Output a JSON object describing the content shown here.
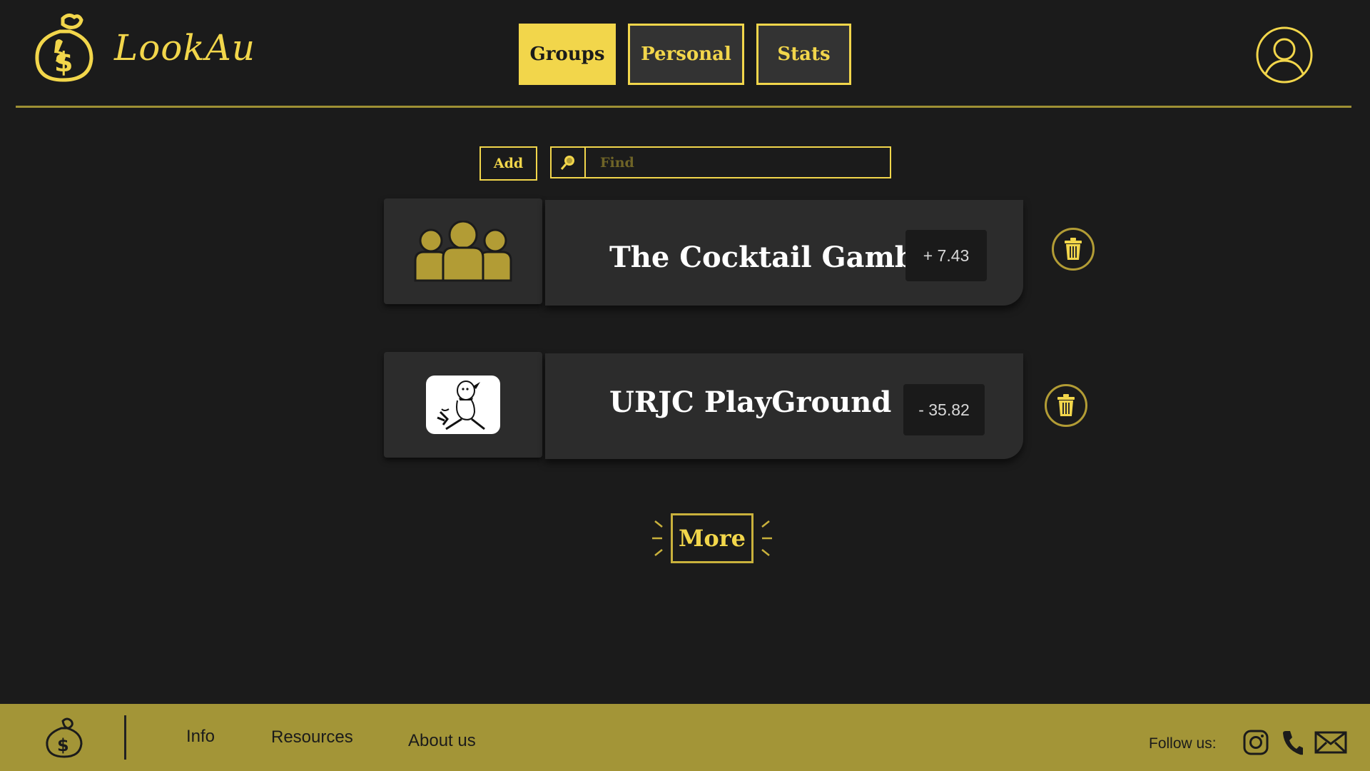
{
  "app": {
    "logo_text": "LookAu"
  },
  "nav": {
    "tabs": [
      "Groups",
      "Personal",
      "Stats"
    ],
    "active": "Groups"
  },
  "toolbar": {
    "add_label": "Add",
    "search_placeholder": "Find"
  },
  "groups": [
    {
      "name": "The Cocktail Gambit",
      "amount": "+ 7.43",
      "icon": "group-people-icon"
    },
    {
      "name": "URJC PlayGround",
      "amount": "- 35.82",
      "icon": "penguin-avatar"
    }
  ],
  "more_label": "More",
  "footer": {
    "links": [
      "Info",
      "Resources",
      "About us"
    ],
    "follow_label": "Follow  us:"
  },
  "colors": {
    "accent": "#f2d64b",
    "footer_bg": "#a39537",
    "background": "#1b1b1b",
    "card": "#2c2c2c"
  }
}
